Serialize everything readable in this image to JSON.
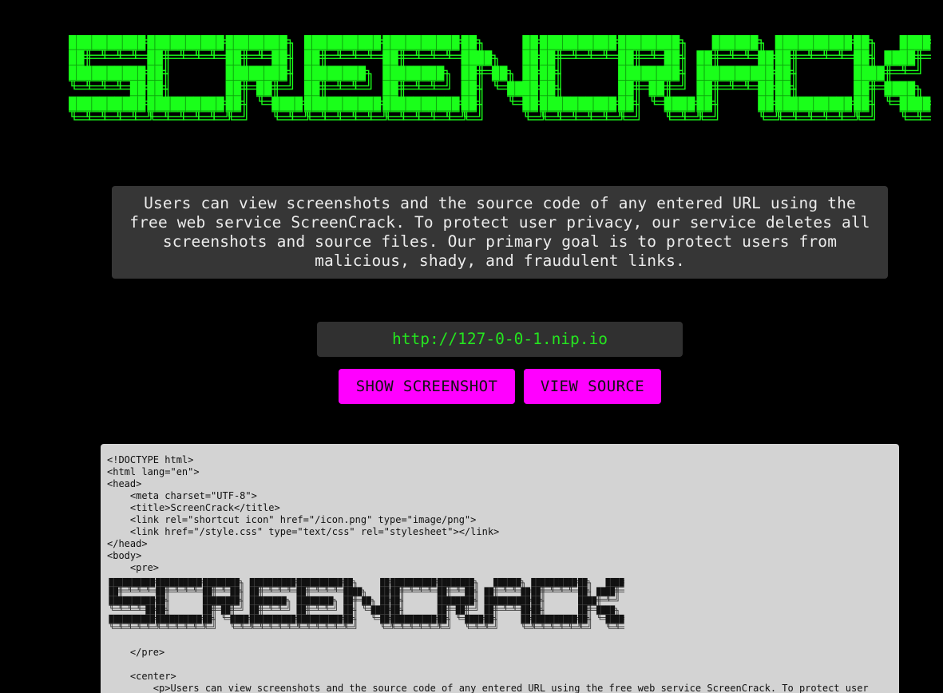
{
  "logo": {
    "text": "SCREENCRACK",
    "color": "#1aff1a",
    "outline_color": "#1aff1a"
  },
  "description": "Users can view screenshots and the source code of any entered URL using the free web service ScreenCrack. To protect user privacy, our service deletes all screenshots and source files. Our primary goal is to protect users from malicious, shady, and fraudulent links.",
  "url_input": {
    "value": "http://127-0-0-1.nip.io"
  },
  "buttons": {
    "screenshot": "SHOW SCREENSHOT",
    "view_source": "VIEW SOURCE"
  },
  "source_view": {
    "lines_before_art": [
      "<!DOCTYPE html>",
      "<html lang=\"en\">",
      "<head>",
      "    <meta charset=\"UTF-8\">",
      "    <title>ScreenCrack</title>",
      "    <link rel=\"shortcut icon\" href=\"/icon.png\" type=\"image/png\">",
      "    <link href=\"/style.css\" type=\"text/css\" rel=\"stylesheet\"></link>",
      "</head>",
      "<body>",
      "    <pre>"
    ],
    "lines_after_art": [
      "    </pre>",
      "",
      "    <center>",
      "        <p>Users can view screenshots and the source code of any entered URL using the free web service ScreenCrack. To protect user"
    ]
  },
  "colors": {
    "background": "#000000",
    "accent_green": "#1aff1a",
    "button_magenta": "#ff00ff",
    "panel_dark": "#363636",
    "panel_light": "#d3d3d3"
  }
}
